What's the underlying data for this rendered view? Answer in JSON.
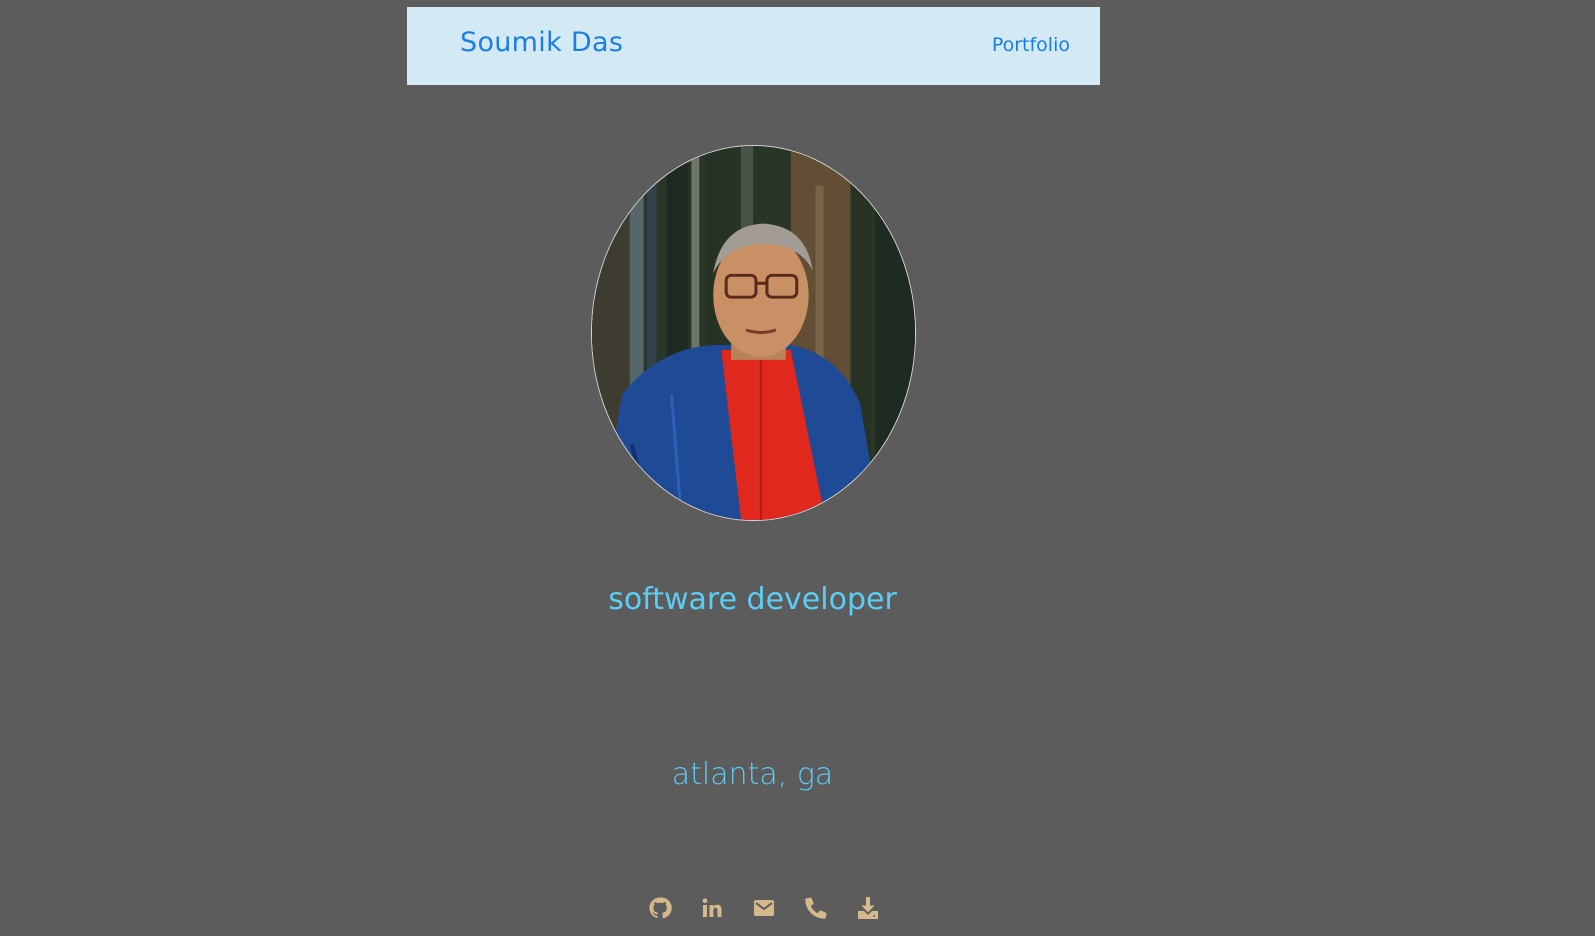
{
  "navbar": {
    "brand": "Soumik Das",
    "link": "Portfolio"
  },
  "profile": {
    "role": "software developer",
    "location": "atlanta, ga"
  },
  "social": [
    {
      "icon": "github-icon"
    },
    {
      "icon": "linkedin-icon"
    },
    {
      "icon": "email-icon"
    },
    {
      "icon": "phone-icon"
    },
    {
      "icon": "download-icon"
    }
  ],
  "colors": {
    "background": "#5b5c5b",
    "navbar": "#d3eaf4",
    "link": "#1a7fe0",
    "accent_text": "#5ccdf5",
    "icon": "#d6b98a"
  }
}
